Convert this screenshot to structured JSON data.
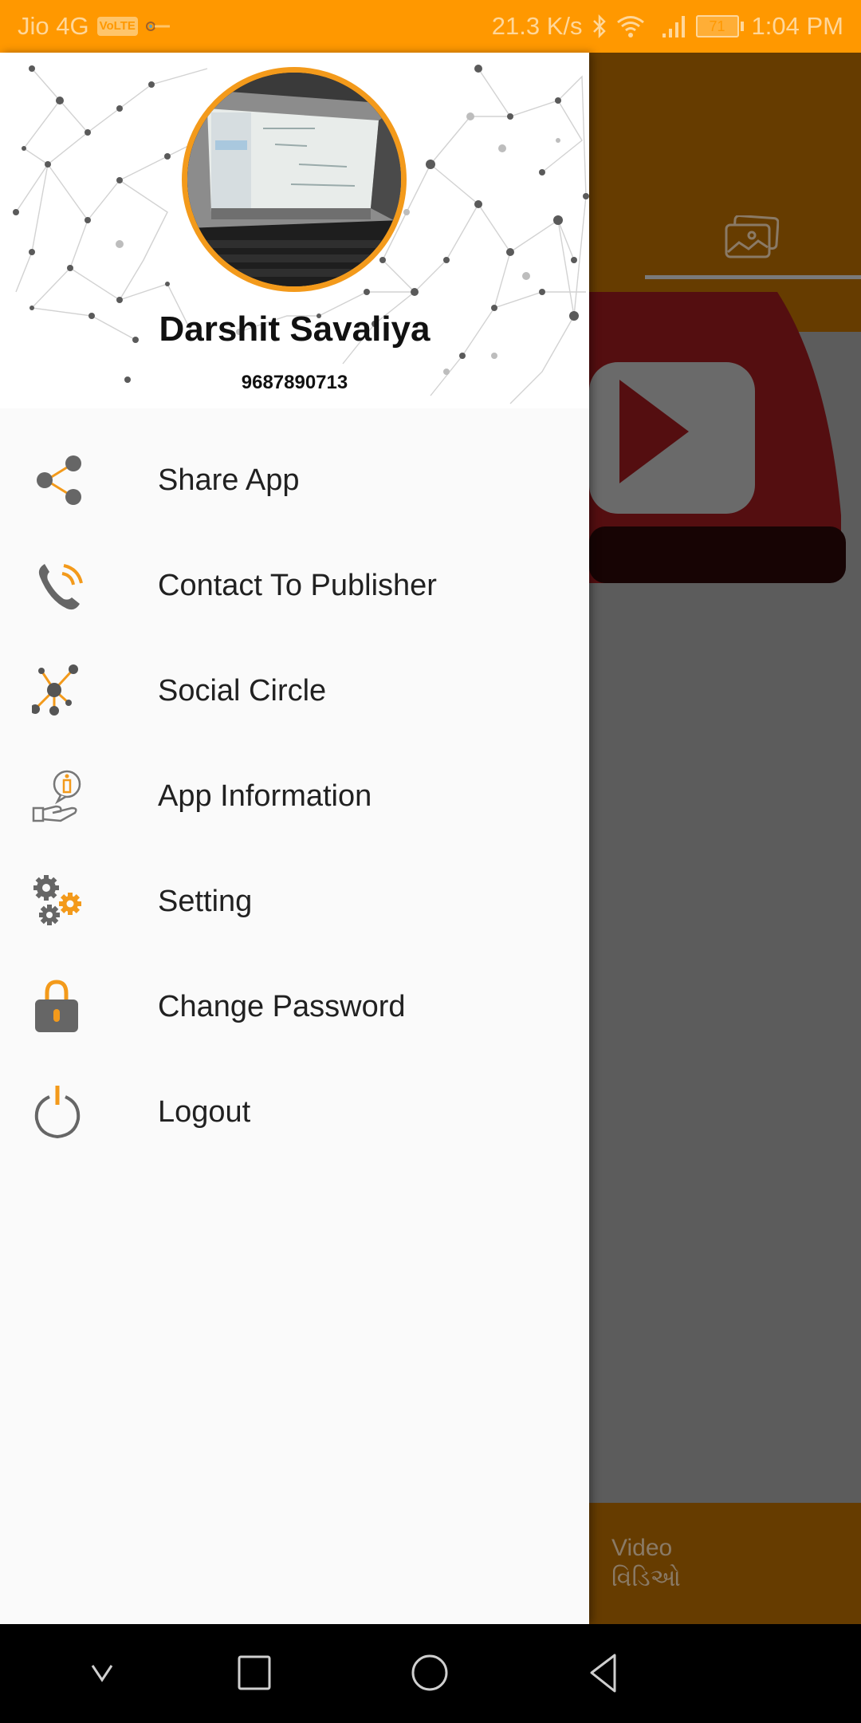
{
  "status_bar": {
    "carrier": "Jio 4G",
    "volte_badge": "VoLTE",
    "speed": "21.3 K/s",
    "battery": "71",
    "time": "1:04 PM",
    "icons": [
      "key-icon",
      "bluetooth-icon",
      "wifi-icon",
      "signal-icon",
      "battery-icon"
    ]
  },
  "drawer": {
    "profile": {
      "name": "Darshit Savaliya",
      "phone": "9687890713",
      "avatar_icon": "profile-photo"
    },
    "menu_items": [
      {
        "label": "Share App",
        "icon": "share-icon"
      },
      {
        "label": "Contact To Publisher",
        "icon": "phone-call-icon"
      },
      {
        "label": "Social Circle",
        "icon": "network-nodes-icon"
      },
      {
        "label": "App Information",
        "icon": "info-hand-icon"
      },
      {
        "label": "Setting",
        "icon": "gears-icon"
      },
      {
        "label": "Change Password",
        "icon": "lock-icon"
      },
      {
        "label": "Logout",
        "icon": "power-icon"
      }
    ]
  },
  "background_app": {
    "tab_icon": "gallery-icon",
    "video_tab": {
      "label_en": "Video",
      "label_gu": "વિડિઓ"
    }
  },
  "navigation_bar": {
    "buttons": [
      "collapse",
      "recents",
      "home",
      "back"
    ]
  },
  "colors": {
    "accent": "#ff9800",
    "icon_gray": "#666666",
    "icon_orange": "#f39a1b",
    "toolbar_dimmed": "#663c00",
    "drawer_bg": "#fafafa"
  }
}
